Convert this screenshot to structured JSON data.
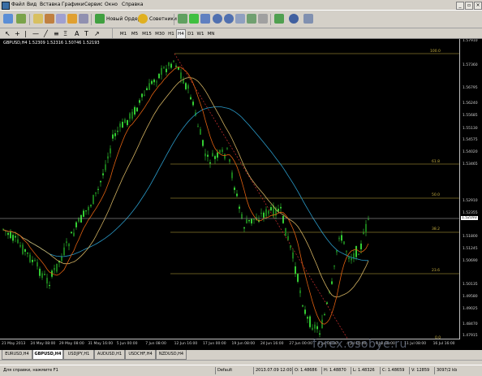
{
  "menu": [
    "Файл",
    "Вид",
    "Вставка",
    "Графики",
    "Сервис",
    "Окно",
    "Справка"
  ],
  "toolbar1": {
    "new_order": "Новый Ордер",
    "advisors": "Советники"
  },
  "toolbar2": {
    "timeframes": [
      "M1",
      "M5",
      "M15",
      "M30",
      "H1",
      "H4",
      "D1",
      "W1",
      "MN"
    ],
    "active_timeframe": "H4"
  },
  "chart": {
    "header": "GBPUSD,H4  1.52309 1.52316 1.50746 1.52193",
    "price_labels": [
      "1.57910",
      "1.57360",
      "1.56795",
      "1.56240",
      "1.55685",
      "1.55130",
      "1.54575",
      "1.54020",
      "1.53465",
      "1.52910",
      "1.52355",
      "1.51800",
      "1.51245",
      "1.50690",
      "1.50135",
      "1.49580",
      "1.49025",
      "1.48470",
      "1.47915"
    ],
    "current_price": "1.52193",
    "time_labels": [
      "21 May 2013",
      "24 May 08:00",
      "29 May 08:00",
      "31 May 16:00",
      "5 Jun 00:00",
      "7 Jun 08:00",
      "12 Jun 16:00",
      "17 Jun 00:00",
      "19 Jun 08:00",
      "24 Jun 16:00",
      "27 Jun 00:00",
      "2 Jul 08:00",
      "4 Jul 16:00",
      "9 Jul 00:00",
      "11 Jul 08:00",
      "16 Jul 16:00"
    ],
    "fib_levels": [
      "100.0",
      "61.8",
      "50.0",
      "38.2",
      "23.6",
      "0.0"
    ]
  },
  "watermark": "forex.osobye.ru",
  "tabs": [
    "EURUSD,H4",
    "GBPUSD,H4",
    "USDJPY,H1",
    "AUDUSD,H1",
    "USDCHF,H4",
    "NZDUSD,H4"
  ],
  "active_tab": "GBPUSD,H4",
  "status": {
    "help": "Для справки, нажмите F1",
    "profile": "Default",
    "datetime": "2013.07.09 12:00",
    "open": "O: 1.48686",
    "high": "H: 1.48870",
    "low": "L: 1.48326",
    "close": "C: 1.48659",
    "volume": "V: 12859",
    "traffic": "3097/2 kb"
  },
  "colors": {
    "bull_candle": "#33cc33",
    "bear_candle": "#1a7a1a",
    "ma_fast": "#e06010",
    "ma_mid": "#d0b060",
    "ma_slow": "#2a9ac8",
    "fib": "#c8b040",
    "chart_bg": "#000000"
  }
}
